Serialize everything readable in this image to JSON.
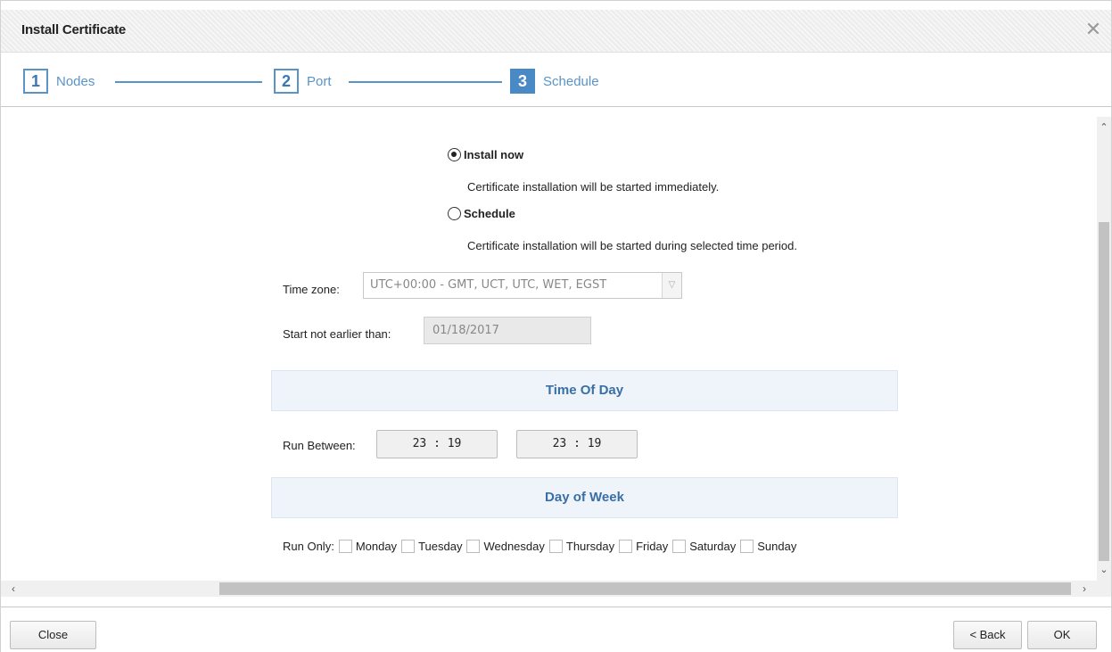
{
  "dialog": {
    "title": "Install Certificate"
  },
  "wizard": {
    "steps": [
      {
        "number": "1",
        "label": "Nodes"
      },
      {
        "number": "2",
        "label": "Port"
      },
      {
        "number": "3",
        "label": "Schedule"
      }
    ],
    "active_step": 3
  },
  "schedule": {
    "install_now": {
      "label": "Install now",
      "selected": true,
      "description": "Certificate installation will be started immediately."
    },
    "schedule_option": {
      "label": "Schedule",
      "selected": false,
      "description": "Certificate installation will be started during selected time period."
    },
    "timezone": {
      "label": "Time zone:",
      "value": "UTC+00:00 - GMT, UCT, UTC, WET, EGST"
    },
    "start_date": {
      "label": "Start not earlier than:",
      "value": "01/18/2017"
    },
    "time_of_day": {
      "header": "Time Of Day",
      "label": "Run Between:",
      "start": "23 : 19",
      "end": "23 : 19"
    },
    "day_of_week": {
      "header": "Day of Week",
      "label": "Run Only:",
      "days": [
        "Monday",
        "Tuesday",
        "Wednesday",
        "Thursday",
        "Friday",
        "Saturday",
        "Sunday"
      ]
    }
  },
  "footer": {
    "close_label": "Close",
    "back_label": "< Back",
    "ok_label": "OK"
  },
  "colors": {
    "accent": "#5a93c6",
    "section_header_text": "#3a6fa5",
    "section_header_bg": "#eef4fa"
  }
}
